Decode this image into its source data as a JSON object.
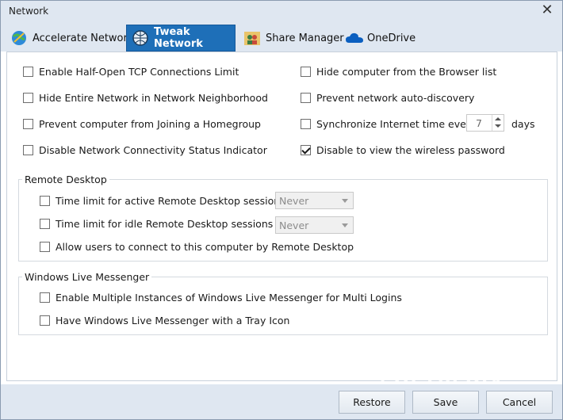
{
  "window": {
    "title": "Network"
  },
  "tabs": [
    {
      "label": "Accelerate Network"
    },
    {
      "label": "Tweak Network"
    },
    {
      "label": "Share Manager"
    },
    {
      "label": "OneDrive"
    }
  ],
  "options": {
    "half_open": {
      "label": "Enable Half-Open TCP Connections Limit",
      "checked": false
    },
    "hide_entire": {
      "label": "Hide Entire Network in Network Neighborhood",
      "checked": false
    },
    "prevent_homegroup": {
      "label": "Prevent computer from Joining a Homegroup",
      "checked": false
    },
    "disable_ncsi": {
      "label": "Disable Network Connectivity Status Indicator",
      "checked": false
    },
    "hide_browser": {
      "label": "Hide computer from the Browser list",
      "checked": false
    },
    "prevent_discovery": {
      "label": "Prevent network auto-discovery",
      "checked": false
    },
    "sync_time": {
      "label": "Synchronize Internet time every",
      "checked": false,
      "value": "7",
      "unit": "days"
    },
    "disable_wireless_pw": {
      "label": "Disable to view the wireless password",
      "checked": true
    }
  },
  "remote_desktop": {
    "title": "Remote Desktop",
    "active_limit": {
      "label": "Time limit for active Remote Desktop sessions",
      "checked": false,
      "selected": "Never"
    },
    "idle_limit": {
      "label": "Time limit for idle Remote Desktop sessions",
      "checked": false,
      "selected": "Never"
    },
    "allow_connect": {
      "label": "Allow users to connect to this computer by Remote Desktop",
      "checked": false
    }
  },
  "messenger": {
    "title": "Windows Live Messenger",
    "multi_instances": {
      "label": "Enable Multiple Instances of Windows Live Messenger for Multi Logins",
      "checked": false
    },
    "tray_icon": {
      "label": "Have Windows Live Messenger with a Tray Icon",
      "checked": false
    }
  },
  "footer": {
    "restore": "Restore",
    "save": "Save",
    "cancel": "Cancel"
  },
  "watermark": "SOFTPEDIA",
  "colors": {
    "accent": "#1e6fb8",
    "chrome": "#dfe7f1"
  }
}
